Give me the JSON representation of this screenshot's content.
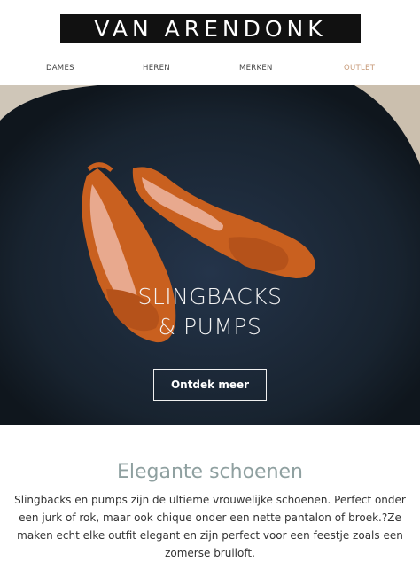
{
  "header": {
    "logo_text": "VAN ARENDONK",
    "nav": [
      {
        "label": "DAMES"
      },
      {
        "label": "HEREN"
      },
      {
        "label": "MERKEN"
      },
      {
        "label": "OUTLET"
      }
    ]
  },
  "hero": {
    "title_line1": "SLINGBACKS",
    "title_line2": "& PUMPS",
    "cta_label": "Ontdek meer",
    "shoe_color": "#c9601f",
    "background_color": "#1c2836"
  },
  "content": {
    "heading": "Elegante schoenen",
    "paragraph": "Slingbacks en pumps zijn de ultieme vrouwelijke schoenen. Perfect onder een jurk of rok, maar ook chique onder een nette pantalon of broek.?Ze maken echt elke outfit elegant en zijn perfect voor een feestje zoals een zomerse bruiloft."
  },
  "colors": {
    "accent_outlet": "#c79a78",
    "heading": "#8fa0a0"
  }
}
